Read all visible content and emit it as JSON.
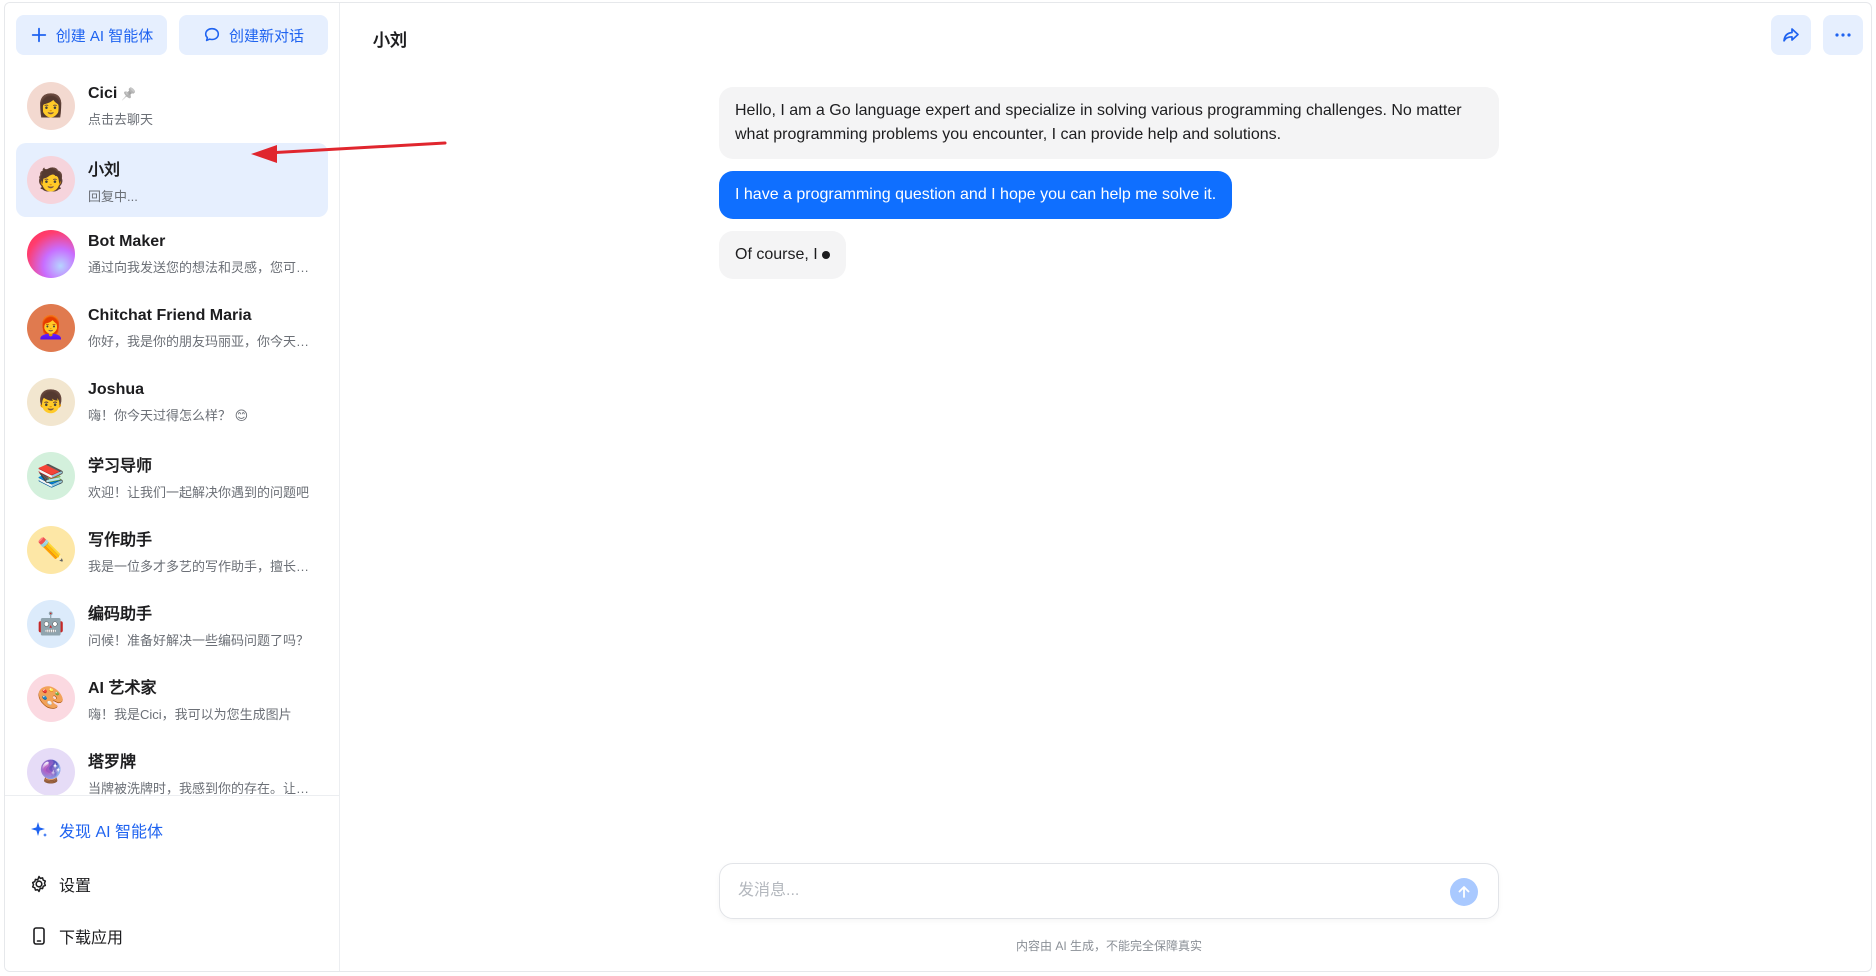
{
  "sidebar": {
    "create_ai_label": "创建 AI 智能体",
    "new_chat_label": "创建新对话",
    "conversations": [
      {
        "name": "Cici",
        "preview": "点击去聊天",
        "pinned": true,
        "avatar_icon": "cici-portrait",
        "avatar_bg": "#f3d9d0",
        "avatar_glyph": "👩"
      },
      {
        "name": "小刘",
        "preview": "回复中...",
        "active": true,
        "avatar_icon": "xiaoliu-portrait",
        "avatar_bg": "#f6d4dc",
        "avatar_glyph": "🧑"
      },
      {
        "name": "Bot Maker",
        "preview": "通过向我发送您的想法和灵感，您可以创建...",
        "avatar_icon": "bot-maker-gradient",
        "avatar_bg": "#ff4d8d",
        "avatar_glyph": ""
      },
      {
        "name": "Chitchat Friend Maria",
        "preview": "你好，我是你的朋友玛丽亚，你今天过得怎么样",
        "avatar_icon": "maria-portrait",
        "avatar_bg": "#e07a4f",
        "avatar_glyph": "👩‍🦰"
      },
      {
        "name": "Joshua",
        "preview": "嗨！你今天过得怎么样？ 😊",
        "avatar_icon": "joshua-portrait",
        "avatar_bg": "#f2e6cf",
        "avatar_glyph": "👦"
      },
      {
        "name": "学习导师",
        "preview": "欢迎！让我们一起解决你遇到的问题吧",
        "avatar_icon": "books-icon",
        "avatar_bg": "#d3f0dc",
        "avatar_glyph": "📚"
      },
      {
        "name": "写作助手",
        "preview": "我是一位多才多艺的写作助手，擅长各种写作",
        "avatar_icon": "pencil-icon",
        "avatar_bg": "#fde7a6",
        "avatar_glyph": "✏️"
      },
      {
        "name": "编码助手",
        "preview": "问候！准备好解决一些编码问题了吗？",
        "avatar_icon": "robot-icon",
        "avatar_bg": "#dcebfb",
        "avatar_glyph": "🤖"
      },
      {
        "name": "AI 艺术家",
        "preview": "嗨！我是Cici，我可以为您生成图片",
        "avatar_icon": "palette-icon",
        "avatar_bg": "#fbd9e1",
        "avatar_glyph": "🎨"
      },
      {
        "name": "塔罗牌",
        "preview": "当牌被洗牌时，我感到你的存在。让我们开始",
        "avatar_icon": "crystal-ball-icon",
        "avatar_bg": "#e6dcf7",
        "avatar_glyph": "🔮"
      }
    ],
    "discover_label": "发现 AI 智能体",
    "settings_label": "设置",
    "download_label": "下载应用"
  },
  "chat": {
    "title": "小刘",
    "messages": [
      {
        "role": "bot",
        "text": "Hello, I am a Go language expert and specialize in solving various programming challenges. No matter what programming problems you encounter, I can provide help and solutions."
      },
      {
        "role": "user",
        "text": "I have a programming question and I hope you can help me solve it."
      },
      {
        "role": "bot",
        "text": "Of course, I",
        "typing": true
      }
    ],
    "input_placeholder": "发消息...",
    "disclaimer": "内容由 AI 生成，不能完全保障真实"
  },
  "colors": {
    "accent": "#1f63f0",
    "user_bubble": "#0f6fff",
    "annotation_arrow": "#e0262e"
  }
}
